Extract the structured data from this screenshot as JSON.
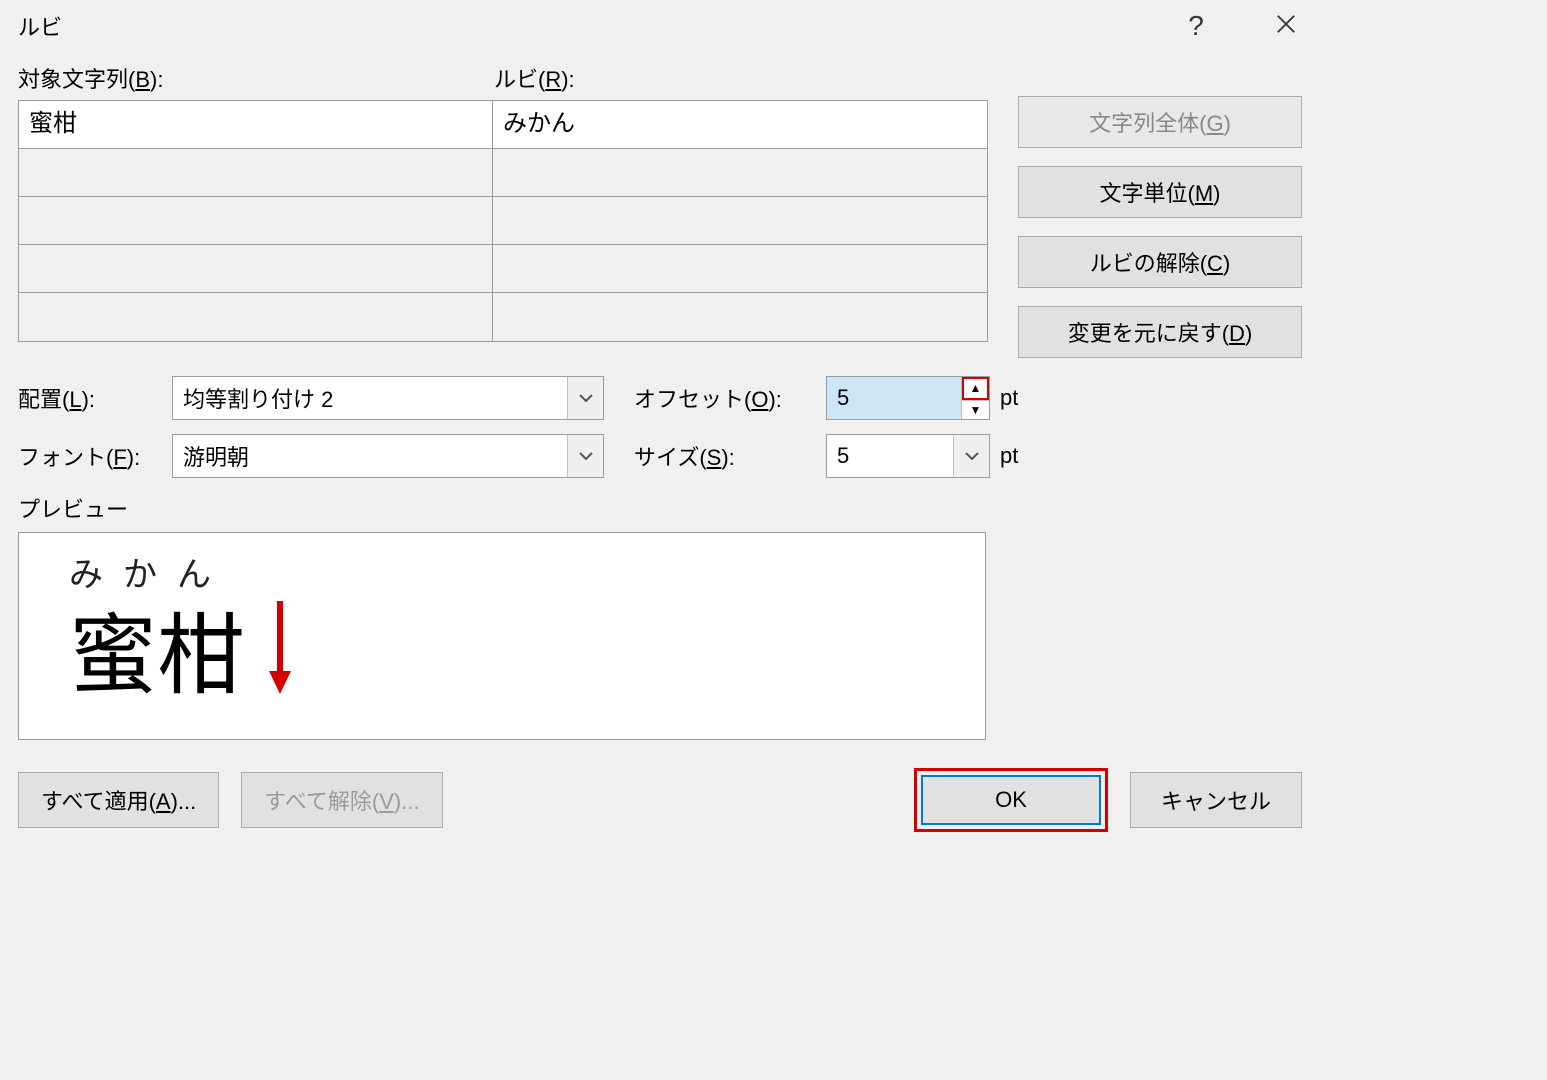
{
  "title": "ルビ",
  "headers": {
    "base": "対象文字列(B):",
    "ruby": "ルビ(R):"
  },
  "rows": [
    {
      "base": "蜜柑",
      "ruby": "みかん"
    },
    {
      "base": "",
      "ruby": ""
    },
    {
      "base": "",
      "ruby": ""
    },
    {
      "base": "",
      "ruby": ""
    },
    {
      "base": "",
      "ruby": ""
    }
  ],
  "side": {
    "whole": "文字列全体(G)",
    "unit": "文字単位(M)",
    "remove": "ルビの解除(C)",
    "reset": "変更を元に戻す(D)"
  },
  "form": {
    "align_label": "配置(L):",
    "align_value": "均等割り付け 2",
    "offset_label": "オフセット(O):",
    "offset_value": "5",
    "font_label": "フォント(F):",
    "font_value": "游明朝",
    "size_label": "サイズ(S):",
    "size_value": "5",
    "unit": "pt"
  },
  "preview": {
    "label": "プレビュー",
    "ruby": "みかん",
    "base": "蜜柑"
  },
  "bottom": {
    "apply_all": "すべて適用(A)...",
    "remove_all": "すべて解除(V)...",
    "ok": "OK",
    "cancel": "キャンセル"
  }
}
